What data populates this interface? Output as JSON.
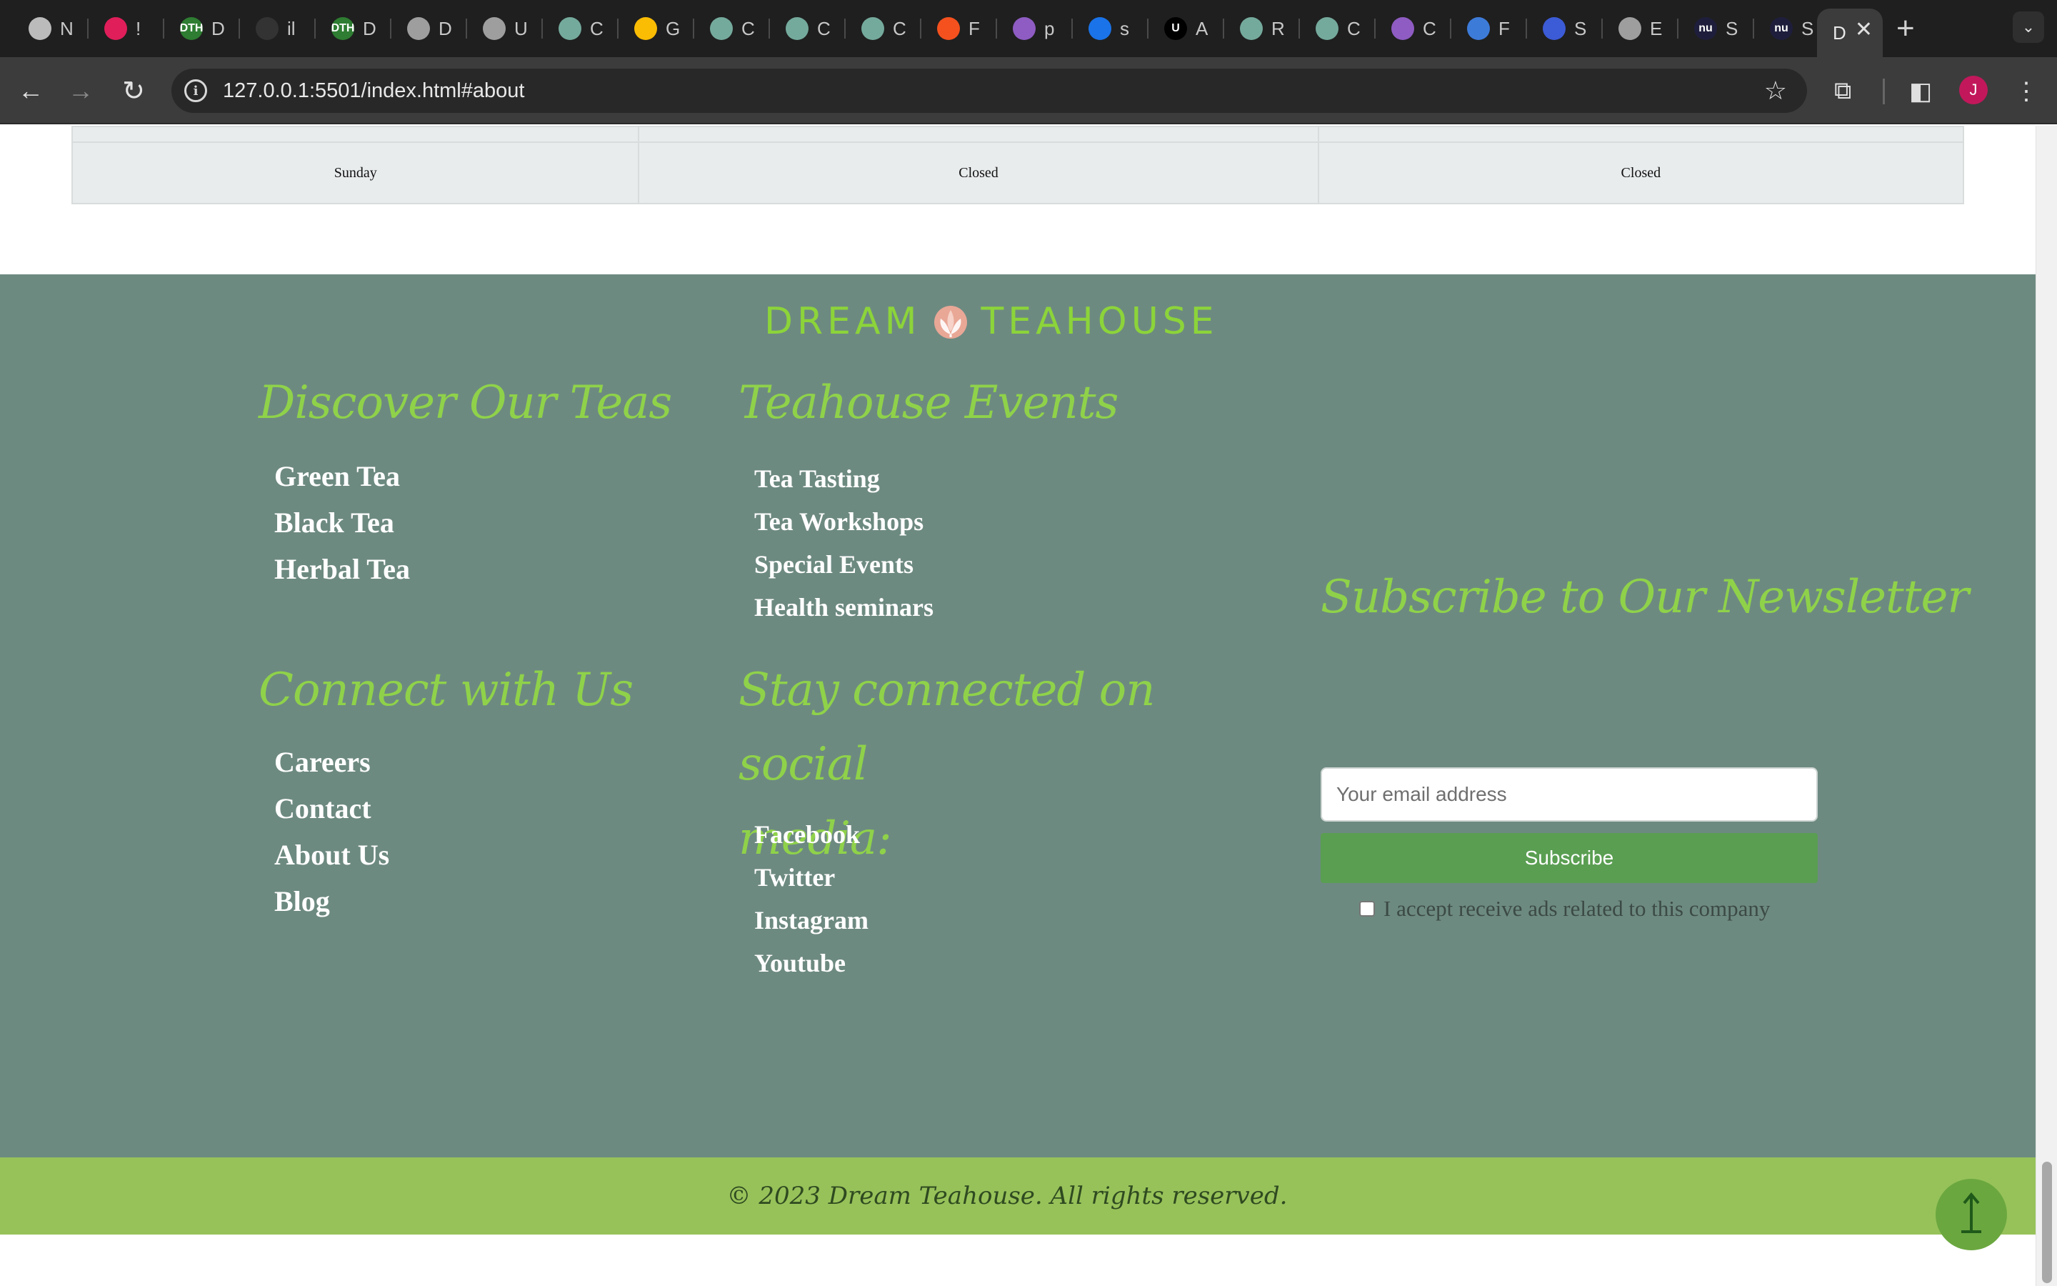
{
  "browser": {
    "tabs": [
      {
        "letter": "N",
        "icon": "chrome-icon",
        "color": "#bbbbbb"
      },
      {
        "letter": "!",
        "icon": "slack-icon",
        "color": "#e01e5a"
      },
      {
        "letter": "D",
        "icon": "dth-icon",
        "color": "#2e7d32",
        "fav_text": "DTH"
      },
      {
        "letter": "il",
        "icon": "github-icon",
        "color": "#333333"
      },
      {
        "letter": "D",
        "icon": "dth-icon",
        "color": "#2e7d32",
        "fav_text": "DTH"
      },
      {
        "letter": "D",
        "icon": "globe-icon",
        "color": "#9e9e9e"
      },
      {
        "letter": "U",
        "icon": "globe-icon",
        "color": "#9e9e9e"
      },
      {
        "letter": "C",
        "icon": "chatgpt-icon",
        "color": "#74aa9c"
      },
      {
        "letter": "G",
        "icon": "google-ads-icon",
        "color": "#fbbc04"
      },
      {
        "letter": "C",
        "icon": "chatgpt-icon",
        "color": "#74aa9c"
      },
      {
        "letter": "C",
        "icon": "chatgpt-icon",
        "color": "#74aa9c"
      },
      {
        "letter": "C",
        "icon": "chatgpt-icon",
        "color": "#74aa9c"
      },
      {
        "letter": "F",
        "icon": "figma-ring-icon",
        "color": "#f4511e"
      },
      {
        "letter": "p",
        "icon": "cube-icon",
        "color": "#8e5cc2"
      },
      {
        "letter": "s",
        "icon": "search-icon",
        "color": "#1a73e8"
      },
      {
        "letter": "A",
        "icon": "u-logo-icon",
        "color": "#000000",
        "fav_text": "U"
      },
      {
        "letter": "R",
        "icon": "chatgpt-icon",
        "color": "#74aa9c"
      },
      {
        "letter": "C",
        "icon": "chatgpt-icon",
        "color": "#74aa9c"
      },
      {
        "letter": "C",
        "icon": "cube-icon",
        "color": "#8e5cc2"
      },
      {
        "letter": "F",
        "icon": "flag-icon",
        "color": "#3d7bd9"
      },
      {
        "letter": "S",
        "icon": "forms-icon",
        "color": "#3c5bd6"
      },
      {
        "letter": "E",
        "icon": "globe-icon",
        "color": "#9e9e9e"
      },
      {
        "letter": "S",
        "icon": "nu-icon",
        "color": "#1e1e3c",
        "fav_text": "nu"
      },
      {
        "letter": "S",
        "icon": "nu-icon",
        "color": "#1e1e3c",
        "fav_text": "nu"
      }
    ],
    "active_tab": {
      "letter": "D"
    },
    "url": "127.0.0.1:5501/index.html#about",
    "profile_initial": "J"
  },
  "hours": {
    "rows": [
      {
        "day": "Sunday",
        "col2": "Closed",
        "col3": "Closed"
      }
    ]
  },
  "footer": {
    "logo": {
      "left": "DREAM",
      "right": "TEAHOUSE"
    },
    "discover": {
      "title": "Discover Our Teas",
      "links": [
        "Green Tea",
        "Black Tea",
        "Herbal Tea"
      ]
    },
    "events": {
      "title": "Teahouse Events",
      "links": [
        "Tea Tasting",
        "Tea Workshops",
        "Special Events",
        "Health seminars"
      ]
    },
    "connect": {
      "title": "Connect with Us",
      "links": [
        "Careers",
        "Contact",
        "About Us",
        "Blog"
      ]
    },
    "social": {
      "title_line1": "Stay connected on social",
      "title_line2": "media:",
      "links": [
        "Facebook",
        "Twitter",
        "Instagram",
        "Youtube"
      ]
    },
    "newsletter": {
      "title": "Subscribe to Our Newsletter",
      "email_placeholder": "Your email address",
      "button_label": "Subscribe",
      "consent_label": "I accept receive ads related to this company"
    },
    "copyright": "© 2023 Dream Teahouse. All rights reserved."
  },
  "colors": {
    "footer_bg": "#6d8a81",
    "accent_green": "#8fd24a",
    "copyright_bg": "#97c25a",
    "button_green": "#5a9e52"
  }
}
